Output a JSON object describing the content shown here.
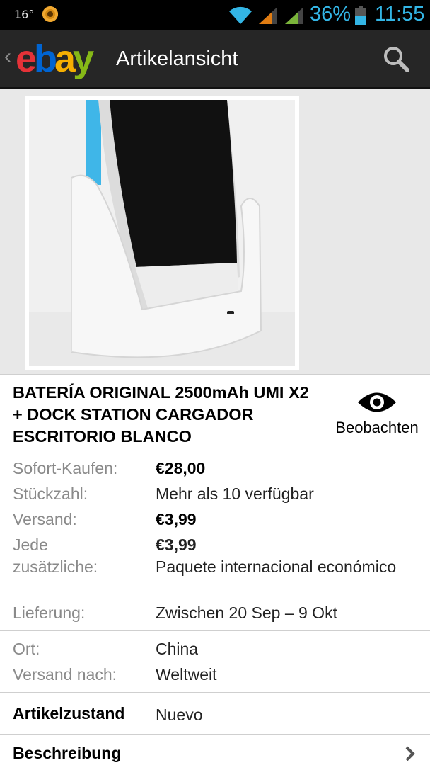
{
  "status_bar": {
    "temperature": "16°",
    "battery_percent": "36%",
    "time": "11:55"
  },
  "action_bar": {
    "logo": {
      "e": "e",
      "b": "b",
      "a": "a",
      "y": "y"
    },
    "title": "Artikelansicht"
  },
  "item": {
    "title": "BATERÍA ORIGINAL 2500mAh UMI X2 + DOCK STATION CARGADOR ESCRITORIO BLANCO",
    "watch_label": "Beobachten"
  },
  "details": {
    "price_label": "Sofort-Kaufen:",
    "price_value": "€28,00",
    "qty_label": "Stückzahl:",
    "qty_value": "Mehr als 10 verfügbar",
    "shipping_label": "Versand:",
    "shipping_value": "€3,99",
    "additional_label_1": "Jede",
    "additional_label_2": "zusätzliche:",
    "additional_value": "€3,99",
    "additional_service": "Paquete internacional económico",
    "delivery_label": "Lieferung:",
    "delivery_value": "Zwischen 20 Sep – 9 Okt",
    "location_label": "Ort:",
    "location_value": "China",
    "ships_to_label": "Versand nach:",
    "ships_to_value": "Weltweit",
    "condition_label": "Artikelzustand",
    "condition_value": "Nuevo",
    "description_label": "Beschreibung"
  },
  "colors": {
    "accent_blue": "#33b5e5",
    "ebay_red": "#e53238",
    "ebay_blue": "#0064d2",
    "ebay_yellow": "#f5af02",
    "ebay_green": "#86b817"
  }
}
